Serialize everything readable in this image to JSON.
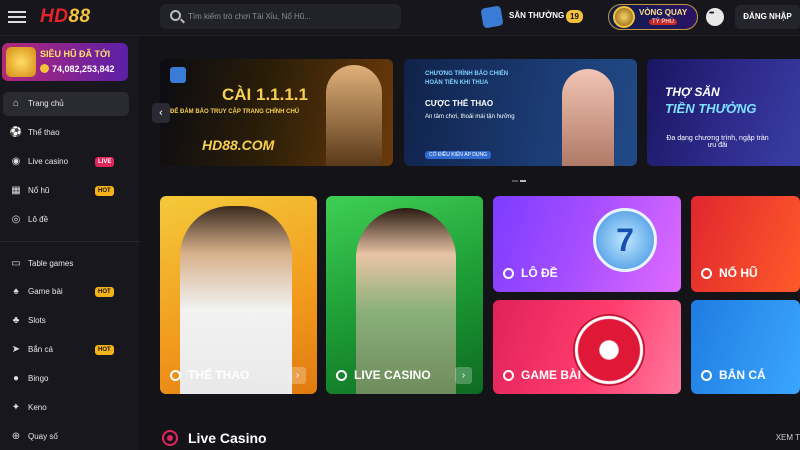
{
  "header": {
    "logo_text_a": "HD",
    "logo_text_b": "88",
    "search_placeholder": "Tìm kiếm trò chơi Tài Xỉu, Nổ Hũ...",
    "reward_label": "SĂN THƯỞNG",
    "reward_count": "19",
    "wheel_label": "VÒNG QUAY",
    "wheel_sub": "TỶ PHÚ",
    "login_label": "ĐĂNG NHẬP"
  },
  "sidebar": {
    "jackpot_title": "SIÊU HŨ ĐÃ TỚI",
    "jackpot_amount": "74,082,253,842",
    "items": [
      {
        "label": "Trang chủ",
        "icon": "home-icon",
        "glyph": "⌂",
        "badge": ""
      },
      {
        "label": "Thể thao",
        "icon": "soccer-ball-icon",
        "glyph": "⚽",
        "badge": ""
      },
      {
        "label": "Live casino",
        "icon": "live-icon",
        "glyph": "◉",
        "badge": "LIVE"
      },
      {
        "label": "Nổ hũ",
        "icon": "slot-machine-icon",
        "glyph": "▦",
        "badge": "HOT"
      },
      {
        "label": "Lô đề",
        "icon": "lottery-ball-icon",
        "glyph": "◎",
        "badge": ""
      },
      {
        "label": "Table games",
        "icon": "table-icon",
        "glyph": "▭",
        "badge": ""
      },
      {
        "label": "Game bài",
        "icon": "cards-icon",
        "glyph": "♠",
        "badge": "HOT"
      },
      {
        "label": "Slots",
        "icon": "cherries-icon",
        "glyph": "♣",
        "badge": ""
      },
      {
        "label": "Bắn cá",
        "icon": "fish-icon",
        "glyph": "➤",
        "badge": "HOT"
      },
      {
        "label": "Bingo",
        "icon": "bingo-icon",
        "glyph": "●",
        "badge": ""
      },
      {
        "label": "Keno",
        "icon": "keno-icon",
        "glyph": "✦",
        "badge": ""
      },
      {
        "label": "Quay số",
        "icon": "lucky-draw-icon",
        "glyph": "⊕",
        "badge": ""
      }
    ]
  },
  "banners": [
    {
      "t1": "CÀI 1.1.1.1",
      "t2": "ĐỂ ĐẢM BẢO TRUY CẬP TRANG CHÍNH CHỦ",
      "t3": "HD88.COM"
    },
    {
      "t1": "CHƯƠNG TRÌNH BẢO CHIẾN",
      "t2": "HOÀN TIỀN KHI THUA",
      "t3": "CƯỢC THỂ THAO",
      "t4": "An tâm chơi, thoải mái tận hưởng",
      "t5": "CÓ ĐIỀU KIỆN ÁP DỤNG"
    },
    {
      "t1": "THỢ SĂN",
      "t2": "TIỀN THƯỞNG",
      "t3": "Đa dạng chương trình, ngập tràn ưu đãi"
    }
  ],
  "cards": [
    {
      "label": "THỂ THAO",
      "icon": "soccer-ball-icon"
    },
    {
      "label": "LIVE CASINO",
      "icon": "live-icon"
    },
    {
      "label": "LÔ ĐỀ",
      "icon": "lottery-ball-icon"
    },
    {
      "label": "NỔ HŨ",
      "icon": "slot-machine-icon"
    },
    {
      "label": "GAME BÀI",
      "icon": "cards-icon"
    },
    {
      "label": "BẮN CÁ",
      "icon": "fish-icon"
    }
  ],
  "section": {
    "title": "Live Casino",
    "more": "XEM T"
  },
  "colors": {
    "accent_red": "#e8232b",
    "gold": "#f3c23a",
    "live_badge": "#e0265a",
    "hot_badge": "#f5b31a"
  }
}
